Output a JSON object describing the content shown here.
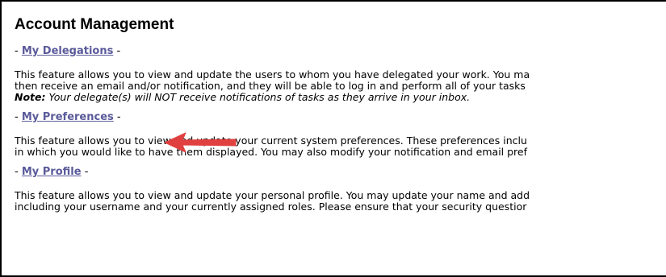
{
  "page": {
    "title": "Account Management"
  },
  "sections": [
    {
      "link": "My Delegations",
      "lines": [
        "This feature allows you to view and update the users to whom you have delegated your work. You ma",
        "then receive an email and/or notification, and they will be able to log in and perform all of your tasks"
      ],
      "note_label": "Note:",
      "note_text": " Your delegate(s) will NOT receive notifications of tasks as they arrive in your inbox."
    },
    {
      "link": "My Preferences",
      "lines": [
        "This feature allows you to view and update your current system preferences. These preferences inclu",
        "in which you would like to have them displayed. You may also modify your notification and email pref"
      ]
    },
    {
      "link": "My Profile",
      "lines": [
        "This feature allows you to view and update your personal profile. You may update your name and add",
        "including your username and your currently assigned roles. Please ensure that your security questior"
      ]
    }
  ],
  "dash": "-",
  "annotation": {
    "arrow_color": "#e04040",
    "arrow_icon": "red-arrow-icon"
  }
}
